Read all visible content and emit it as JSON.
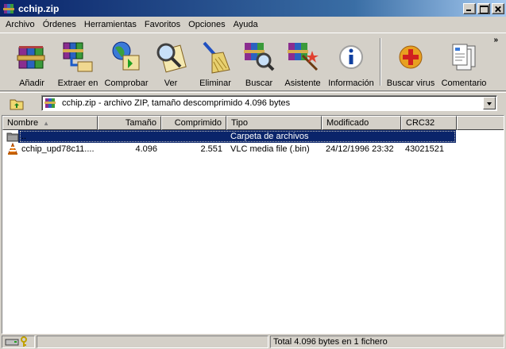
{
  "window": {
    "title": "cchip.zip"
  },
  "menu": [
    "Archivo",
    "Órdenes",
    "Herramientas",
    "Favoritos",
    "Opciones",
    "Ayuda"
  ],
  "toolbar": {
    "buttons": [
      {
        "label": "Añadir",
        "icon": "add-books-icon"
      },
      {
        "label": "Extraer en",
        "icon": "extract-folder-icon"
      },
      {
        "label": "Comprobar",
        "icon": "test-globe-icon"
      },
      {
        "label": "Ver",
        "icon": "view-magnifier-icon"
      },
      {
        "label": "Eliminar",
        "icon": "delete-broom-icon"
      },
      {
        "label": "Buscar",
        "icon": "find-magnifier-icon"
      },
      {
        "label": "Asistente",
        "icon": "wizard-wand-icon"
      },
      {
        "label": "Información",
        "icon": "info-icon"
      },
      {
        "label": "Buscar virus",
        "icon": "virus-scan-icon"
      },
      {
        "label": "Comentario",
        "icon": "comment-icon"
      }
    ],
    "more": "»"
  },
  "address": {
    "value": "cchip.zip - archivo ZIP, tamaño descomprimido 4.096 bytes"
  },
  "columns": [
    "Nombre",
    "Tamaño",
    "Comprimido",
    "Tipo",
    "Modificado",
    "CRC32"
  ],
  "rows": [
    {
      "name": "..",
      "size": "",
      "packed": "",
      "type": "Carpeta de archivos",
      "modified": "",
      "crc": "",
      "selected": true
    },
    {
      "name": "cchip_upd78c11....",
      "size": "4.096",
      "packed": "2.551",
      "type": "VLC media file (.bin)",
      "modified": "24/12/1996 23:32",
      "crc": "43021521",
      "selected": false
    }
  ],
  "status": {
    "text": "Total 4.096 bytes en 1 fichero"
  },
  "colors": {
    "titlebar": "#0a246a",
    "selection": "#0a246a",
    "face": "#d4d0c8"
  }
}
